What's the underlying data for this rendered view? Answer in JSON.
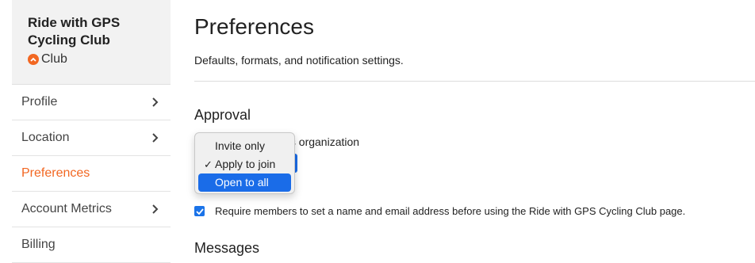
{
  "sidebar": {
    "org_name": "Ride with GPS Cycling Club",
    "org_type": "Club",
    "items": [
      {
        "label": "Profile"
      },
      {
        "label": "Location"
      },
      {
        "label": "Preferences"
      },
      {
        "label": "Account Metrics"
      },
      {
        "label": "Billing"
      }
    ]
  },
  "main": {
    "title": "Preferences",
    "subtitle": "Defaults, formats, and notification settings.",
    "approval": {
      "heading": "Approval",
      "label_tail": "his organization"
    },
    "require_info": {
      "checked": true,
      "label": "Require members to set a name and email address before using the Ride with GPS Cycling Club page."
    },
    "messages_heading": "Messages"
  },
  "dropdown": {
    "options": [
      "Invite only",
      "Apply to join",
      "Open to all"
    ],
    "selected": "Apply to join",
    "highlighted": "Open to all"
  },
  "colors": {
    "accent": "#f26722",
    "highlight": "#1a6ce8"
  }
}
